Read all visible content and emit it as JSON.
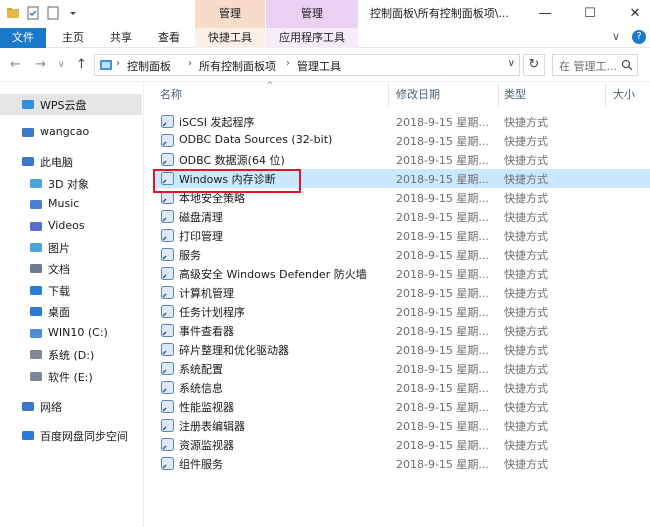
{
  "titlebar": {
    "ctx_tab_a": "管理",
    "ctx_tab_b": "管理",
    "window_title": "控制面板\\所有控制面板项\\...",
    "minimize": "—",
    "maximize": "☐",
    "close": "✕"
  },
  "ribbon": {
    "tabs": [
      "文件",
      "主页",
      "共享",
      "查看",
      "快捷工具",
      "应用程序工具"
    ],
    "collapse_glyph": "∨",
    "help_glyph": "?"
  },
  "address": {
    "back": "←",
    "forward": "→",
    "dropdown": "∨",
    "up": "↑",
    "crumbs": [
      "控制面板",
      "所有控制面板项",
      "管理工具"
    ],
    "sep": "›",
    "refresh": "↻",
    "search_placeholder": "在 管理工..."
  },
  "sidebar": {
    "items": [
      {
        "label": "WPS云盘",
        "icon": "cloud-icon",
        "selected": true
      },
      {
        "label": "wangcao",
        "icon": "user-icon"
      },
      {
        "label": "此电脑",
        "icon": "computer-icon"
      },
      {
        "label": "3D 对象",
        "icon": "3d-objects-icon"
      },
      {
        "label": "Music",
        "icon": "music-icon"
      },
      {
        "label": "Videos",
        "icon": "video-icon"
      },
      {
        "label": "图片",
        "icon": "pictures-icon"
      },
      {
        "label": "文档",
        "icon": "documents-icon"
      },
      {
        "label": "下载",
        "icon": "download-icon"
      },
      {
        "label": "桌面",
        "icon": "desktop-icon"
      },
      {
        "label": "WIN10 (C:)",
        "icon": "windows-drive-icon"
      },
      {
        "label": "系统 (D:)",
        "icon": "drive-icon"
      },
      {
        "label": "软件 (E:)",
        "icon": "drive-icon"
      },
      {
        "label": "网络",
        "icon": "network-icon"
      },
      {
        "label": "百度网盘同步空间",
        "icon": "baidu-sync-icon"
      }
    ]
  },
  "list": {
    "columns": {
      "name": "名称",
      "date": "修改日期",
      "type": "类型",
      "size": "大小"
    },
    "sort_glyph": "^",
    "rows": [
      {
        "name": "iSCSI 发起程序",
        "date": "2018-9-15 星期...",
        "type": "快捷方式",
        "icon": "iscsi-icon"
      },
      {
        "name": "ODBC Data Sources (32-bit)",
        "date": "2018-9-15 星期...",
        "type": "快捷方式",
        "icon": "odbc-icon"
      },
      {
        "name": "ODBC 数据源(64 位)",
        "date": "2018-9-15 星期...",
        "type": "快捷方式",
        "icon": "odbc-icon"
      },
      {
        "name": "Windows 内存诊断",
        "date": "2018-9-15 星期...",
        "type": "快捷方式",
        "icon": "memory-diagnostic-icon",
        "selected": true
      },
      {
        "name": "本地安全策略",
        "date": "2018-9-15 星期...",
        "type": "快捷方式",
        "icon": "security-policy-icon"
      },
      {
        "name": "磁盘清理",
        "date": "2018-9-15 星期...",
        "type": "快捷方式",
        "icon": "disk-cleanup-icon"
      },
      {
        "name": "打印管理",
        "date": "2018-9-15 星期...",
        "type": "快捷方式",
        "icon": "print-management-icon"
      },
      {
        "name": "服务",
        "date": "2018-9-15 星期...",
        "type": "快捷方式",
        "icon": "services-icon"
      },
      {
        "name": "高级安全 Windows Defender 防火墙",
        "date": "2018-9-15 星期...",
        "type": "快捷方式",
        "icon": "firewall-icon"
      },
      {
        "name": "计算机管理",
        "date": "2018-9-15 星期...",
        "type": "快捷方式",
        "icon": "computer-management-icon"
      },
      {
        "name": "任务计划程序",
        "date": "2018-9-15 星期...",
        "type": "快捷方式",
        "icon": "task-scheduler-icon"
      },
      {
        "name": "事件查看器",
        "date": "2018-9-15 星期...",
        "type": "快捷方式",
        "icon": "event-viewer-icon"
      },
      {
        "name": "碎片整理和优化驱动器",
        "date": "2018-9-15 星期...",
        "type": "快捷方式",
        "icon": "defrag-icon"
      },
      {
        "name": "系统配置",
        "date": "2018-9-15 星期...",
        "type": "快捷方式",
        "icon": "system-config-icon"
      },
      {
        "name": "系统信息",
        "date": "2018-9-15 星期...",
        "type": "快捷方式",
        "icon": "system-info-icon"
      },
      {
        "name": "性能监视器",
        "date": "2018-9-15 星期...",
        "type": "快捷方式",
        "icon": "performance-monitor-icon"
      },
      {
        "name": "注册表编辑器",
        "date": "2018-9-15 星期...",
        "type": "快捷方式",
        "icon": "registry-editor-icon"
      },
      {
        "name": "资源监视器",
        "date": "2018-9-15 星期...",
        "type": "快捷方式",
        "icon": "resource-monitor-icon"
      },
      {
        "name": "组件服务",
        "date": "2018-9-15 星期...",
        "type": "快捷方式",
        "icon": "component-services-icon"
      }
    ]
  },
  "colors": {
    "accent": "#1979ca",
    "selection": "#cce8ff",
    "highlight_box": "#e8132b",
    "ctx_tab_a": "#f7dcc9",
    "ctx_tab_b": "#ead1f4"
  }
}
